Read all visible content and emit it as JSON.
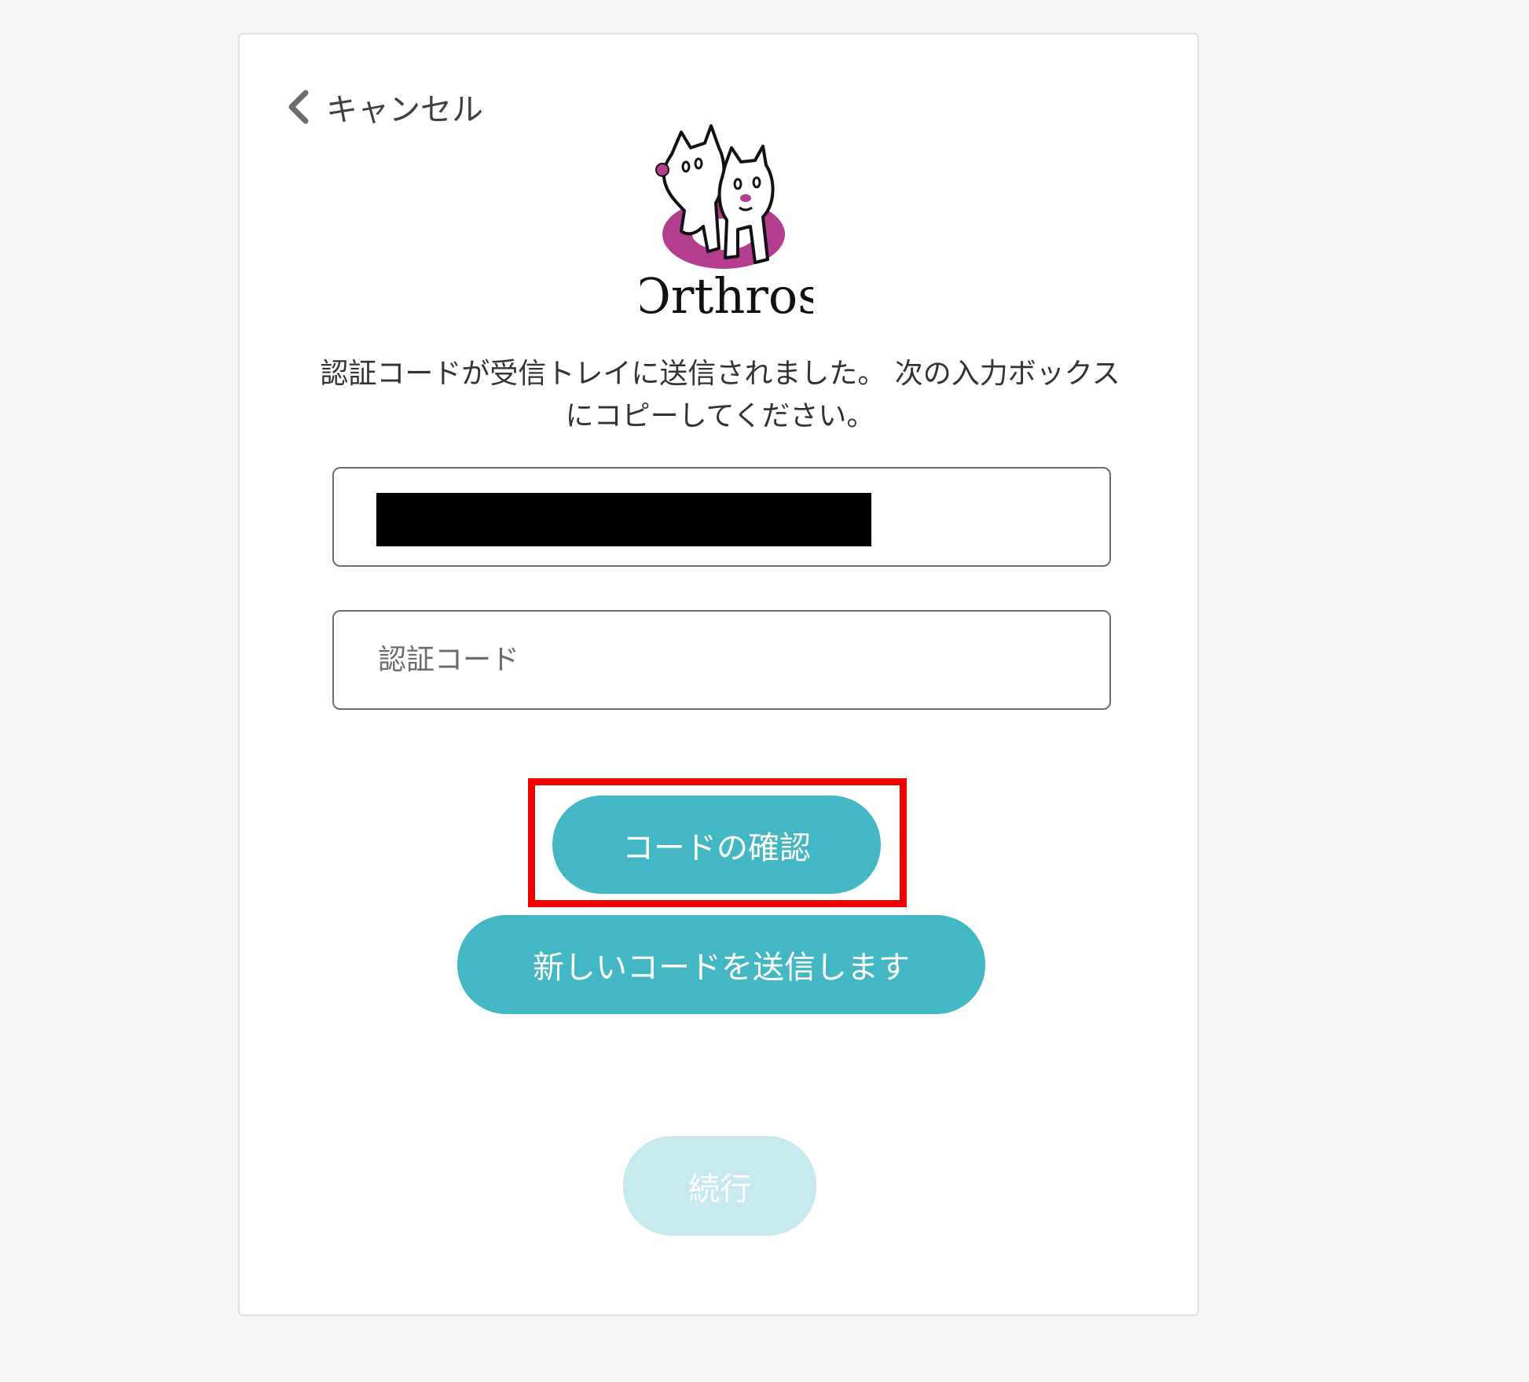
{
  "cancel": {
    "label": "キャンセル",
    "icon": "chevron-left-icon"
  },
  "logo": {
    "text": "Orthros",
    "accent_color": "#b53d8f"
  },
  "message": "認証コードが受信トレイに送信されました。 次の入力ボックスにコピーしてください。",
  "email_field": {
    "value": "",
    "redacted": true
  },
  "code_field": {
    "placeholder": "認証コード",
    "value": ""
  },
  "buttons": {
    "verify_label": "コードの確認",
    "resend_label": "新しいコードを送信します",
    "continue_label": "続行"
  },
  "colors": {
    "primary": "#43b8c4",
    "disabled": "#c6eaed",
    "highlight": "#ee0000"
  }
}
